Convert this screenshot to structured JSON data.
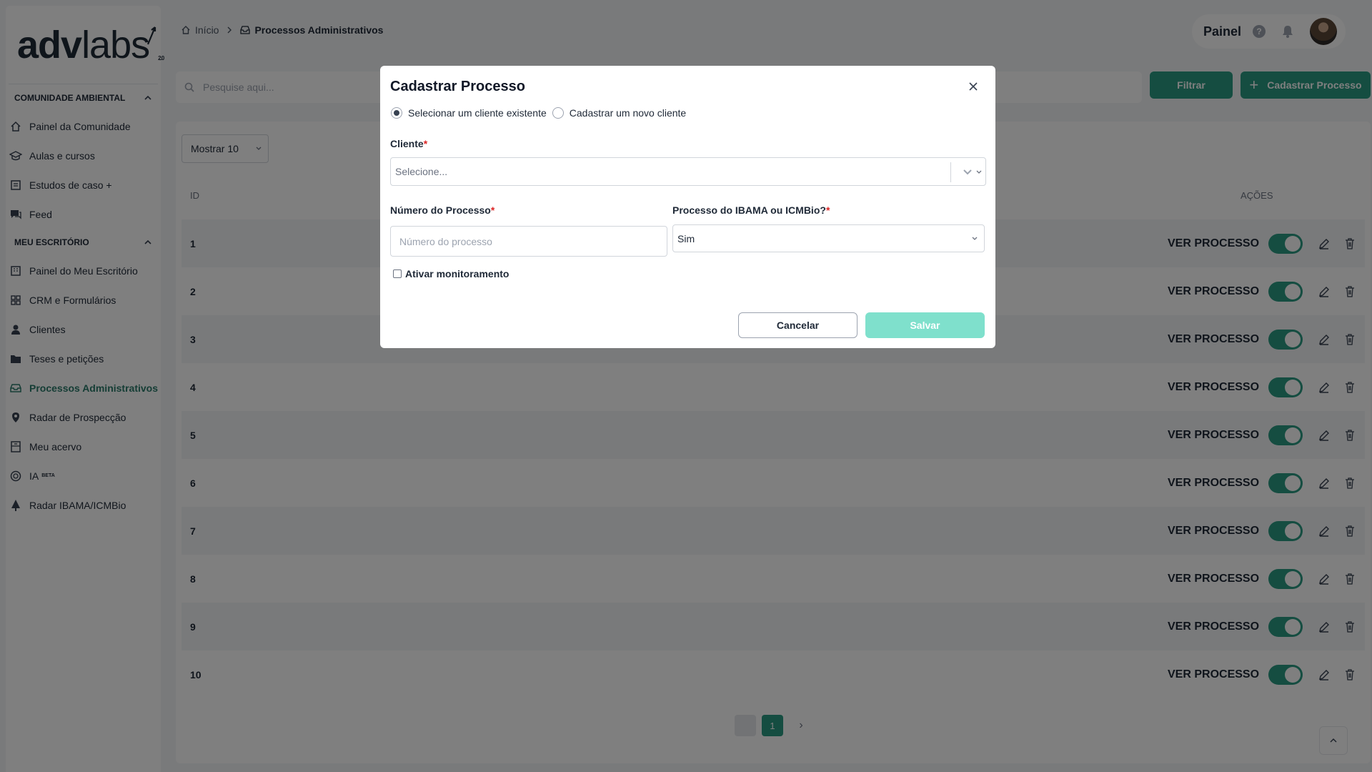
{
  "sidebar": {
    "logo": {
      "adv": "adv",
      "labs": "labs",
      "version": "2.0"
    },
    "sections": [
      {
        "title": "Comunidade ambiental",
        "items": [
          "Painel da Comunidade",
          "Aulas e cursos",
          "Estudos de caso +",
          "Feed"
        ]
      },
      {
        "title": "Meu escritório",
        "items": [
          "Painel do Meu Escritório",
          "CRM e Formulários",
          "Clientes",
          "Teses e petições",
          "Processos Administrativos",
          "Radar de Prospecção",
          "Meu acervo",
          "IA",
          "Radar IBAMA/ICMBio"
        ]
      }
    ],
    "active_item": "Processos Administrativos",
    "ia_badge": "BETA"
  },
  "breadcrumb": {
    "home": "Início",
    "current": "Processos Administrativos"
  },
  "topbar": {
    "label": "Painel",
    "help": "?"
  },
  "search": {
    "placeholder": "Pesquise aqui..."
  },
  "actions": {
    "filter": "Filtrar",
    "add": "Cadastrar Processo"
  },
  "table": {
    "show_select": "Mostrar 10",
    "headers": {
      "id": "ID",
      "actions": "AÇÕES"
    },
    "rows": [
      {
        "id": "1",
        "link": "VER PROCESSO",
        "monitoring": true
      },
      {
        "id": "2",
        "link": "VER PROCESSO",
        "monitoring": true
      },
      {
        "id": "3",
        "link": "VER PROCESSO",
        "monitoring": true
      },
      {
        "id": "4",
        "link": "VER PROCESSO",
        "monitoring": true
      },
      {
        "id": "5",
        "link": "VER PROCESSO",
        "monitoring": true
      },
      {
        "id": "6",
        "link": "VER PROCESSO",
        "monitoring": true
      },
      {
        "id": "7",
        "link": "VER PROCESSO",
        "monitoring": true
      },
      {
        "id": "8",
        "link": "VER PROCESSO",
        "monitoring": true
      },
      {
        "id": "9",
        "link": "VER PROCESSO",
        "monitoring": true
      },
      {
        "id": "10",
        "link": "VER PROCESSO",
        "monitoring": true
      }
    ]
  },
  "pagination": {
    "current": "1",
    "next": "›"
  },
  "modal": {
    "title": "Cadastrar Processo",
    "radio_existing": "Selecionar um cliente existente",
    "radio_new": "Cadastrar um novo cliente",
    "client_label": "Cliente",
    "client_placeholder": "Selecione...",
    "number_label": "Número do Processo",
    "number_placeholder": "Número do processo",
    "ibama_label": "Processo do IBAMA ou ICMBio?",
    "ibama_value": "Sim",
    "monitor_label": "Ativar monitoramento",
    "cancel": "Cancelar",
    "save": "Salvar",
    "required_mark": "*"
  },
  "colors": {
    "accent": "#2b9a82",
    "save_disabled": "#7fe0cc",
    "required": "#dc2626"
  }
}
